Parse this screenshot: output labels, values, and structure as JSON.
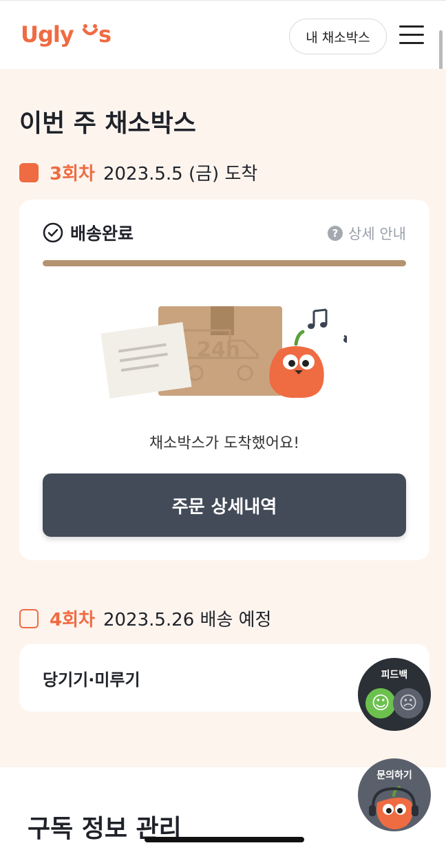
{
  "header": {
    "logo_text": "Ugly Us",
    "my_box_label": "내 채소박스",
    "menu_icon": "hamburger-icon"
  },
  "main": {
    "title": "이번 주 채소박스",
    "current_round": {
      "round_label": "3회차",
      "date_text": "2023.5.5 (금) 도착",
      "status_label": "배송완료",
      "detail_label": "상세 안내",
      "progress": 1.0,
      "message": "채소박스가 도착했어요!",
      "button_label": "주문 상세내역",
      "illustration_text": "24h"
    },
    "next_round": {
      "round_label": "4회차",
      "date_text": "2023.5.26 배송 예정",
      "action_label": "당기기·미루기"
    }
  },
  "subscription": {
    "title": "구독 정보 관리"
  },
  "floating": {
    "feedback_label": "피드백",
    "inquiry_label": "문의하기"
  },
  "colors": {
    "accent": "#ef6b42",
    "background_tint": "#fdf4ee",
    "button_dark": "#434a58",
    "progress": "#b59270"
  }
}
